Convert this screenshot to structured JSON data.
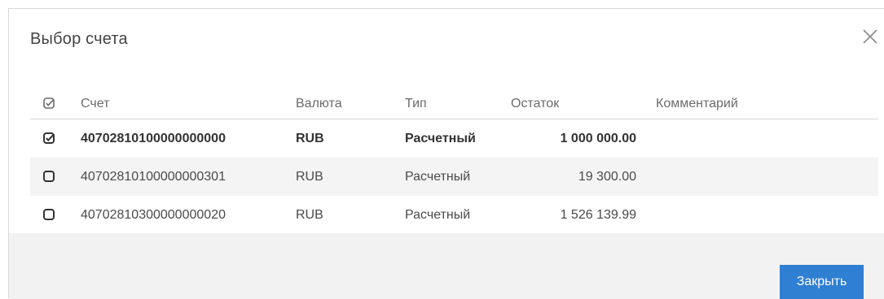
{
  "dialog": {
    "title": "Выбор счета",
    "close_icon": "close-icon"
  },
  "table": {
    "headers": {
      "select_icon": "checkbox-checked-icon",
      "account": "Счет",
      "currency": "Валюта",
      "type": "Тип",
      "balance": "Остаток",
      "comment": "Комментарий"
    },
    "rows": [
      {
        "checked": true,
        "account": "40702810100000000000",
        "currency": "RUB",
        "type": "Расчетный",
        "balance": "1 000 000.00",
        "comment": ""
      },
      {
        "checked": false,
        "account": "40702810100000000301",
        "currency": "RUB",
        "type": "Расчетный",
        "balance": "19 300.00",
        "comment": ""
      },
      {
        "checked": false,
        "account": "40702810300000000020",
        "currency": "RUB",
        "type": "Расчетный",
        "balance": "1 526 139.99",
        "comment": ""
      }
    ]
  },
  "footer": {
    "close_button_label": "Закрыть",
    "close_button_color": "#2f7fd2"
  }
}
